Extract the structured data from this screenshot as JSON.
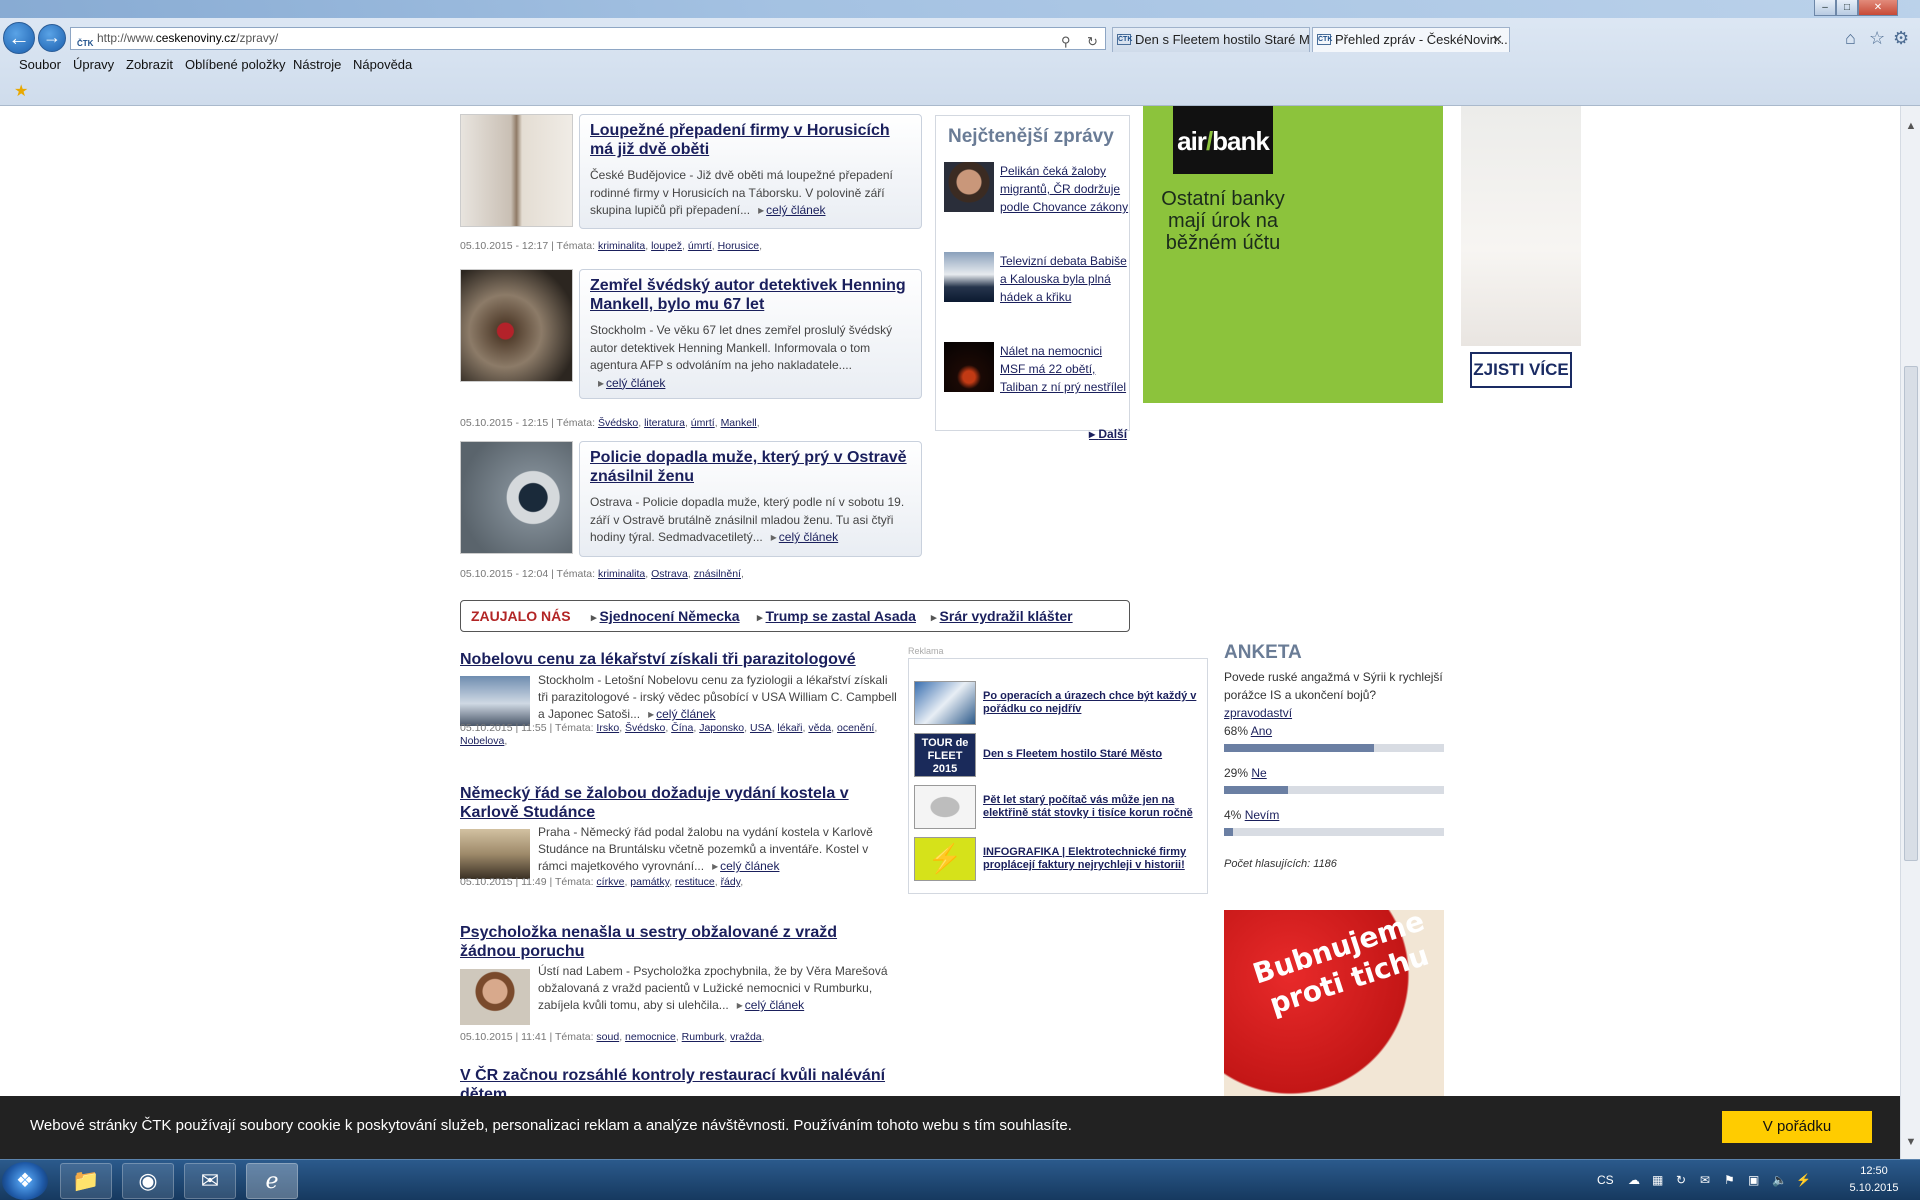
{
  "browser": {
    "url_prefix": "http://www.",
    "url_domain": "ceskenoviny.cz",
    "url_path": "/zpravy/",
    "tabs": [
      {
        "label": "Den s Fleetem hostilo Staré Mě...",
        "fav": "ČTK"
      },
      {
        "label": "Přehled zpráv - ČeskéNovin...",
        "fav": "ČTK",
        "close": "✕"
      }
    ],
    "menu": [
      "Soubor",
      "Úpravy",
      "Zobrazit",
      "Oblíbené položky",
      "Nástroje",
      "Nápověda"
    ],
    "nav_back": "←",
    "nav_forward": "→",
    "icons": {
      "search": "⚲",
      "refresh": "↻",
      "home": "⌂",
      "star": "☆",
      "gear": "⚙",
      "fav_star": "★"
    },
    "window_buttons": {
      "min": "–",
      "max": "□",
      "close": "✕"
    },
    "address_ico": "ČTK"
  },
  "articles": [
    {
      "title": "Loupežné přepadení firmy v Horusicích má již dvě oběti",
      "text": "České Budějovice - Již dvě oběti má loupežné přepadení rodinné firmy v Horusicích na Táborsku. V polovině září skupina lupičů při přepadení...",
      "more": "celý článek",
      "meta": "05.10.2015 - 12:17 | Témata:",
      "tags": [
        "kriminalita",
        "loupež",
        "úmrtí",
        "Horusice"
      ]
    },
    {
      "title": "Zemřel švédský autor detektivek Henning Mankell, bylo mu 67 let",
      "text": "Stockholm - Ve věku 67 let dnes zemřel proslulý švédský autor detektivek Henning Mankell. Informovala o tom agentura AFP s odvoláním na jeho nakladatele....",
      "more": "celý článek",
      "meta": "05.10.2015 - 12:15 | Témata:",
      "tags": [
        "Švédsko",
        "literatura",
        "úmrtí",
        "Mankell"
      ]
    },
    {
      "title": "Policie dopadla muže, který prý v Ostravě znásilnil ženu",
      "text": "Ostrava - Policie dopadla muže, který podle ní v sobotu 19. září v Ostravě brutálně znásilnil mladou ženu. Tu asi čtyři hodiny týral. Sedmadvacetiletý...",
      "more": "celý článek",
      "meta": "05.10.2015 - 12:04 | Témata:",
      "tags": [
        "kriminalita",
        "Ostrava",
        "znásilnění"
      ]
    }
  ],
  "most_read": {
    "title": "Nejčtenější zprávy",
    "items": [
      "Pelikán čeká žaloby migrantů, ČR dodržuje podle Chovance zákony",
      "Televizní debata Babiše a Kalouska byla plná hádek a křiku",
      "Nálet na nemocnici MSF má 22 obětí, Taliban z ní prý nestřílel"
    ],
    "more": "Další"
  },
  "ad_airbank": {
    "logo_a": "air",
    "logo_slash": "/",
    "logo_b": "bank",
    "text": "Ostatní banky mají úrok na běžném účtu"
  },
  "ad_bed": {
    "button": "ZJISTI VÍCE"
  },
  "zaujalo": {
    "label": "ZAUJALO NÁS",
    "links": [
      "Sjednocení Německa",
      "Trump se zastal Asada",
      "Srár vydražil klášter"
    ]
  },
  "list": [
    {
      "title": "Nobelovu cenu za lékařství získali tři parazitologové",
      "text": "Stockholm - Letošní Nobelovu cenu za fyziologii a lékařství získali tři parazitologové - irský vědec působící v USA William C. Campbell a Japonec Satoši...",
      "more": "celý článek",
      "meta": "05.10.2015 | 11:55 | Témata:",
      "tags": [
        "Irsko",
        "Švédsko",
        "Čína",
        "Japonsko",
        "USA",
        "lékaři",
        "věda",
        "ocenění",
        "Nobelova"
      ]
    },
    {
      "title": "Německý řád se žalobou dožaduje vydání kostela v Karlově Studánce",
      "text": "Praha - Německý řád podal žalobu na vydání kostela v Karlově Studánce na Bruntálsku včetně pozemků a inventáře. Kostel v rámci majetkového vyrovnání...",
      "more": "celý článek",
      "meta": "05.10.2015 | 11:49 | Témata:",
      "tags": [
        "církve",
        "památky",
        "restituce",
        "řády"
      ]
    },
    {
      "title": "Psycholožka nenašla u sestry obžalované z vražd žádnou poruchu",
      "text": "Ústí nad Labem - Psycholožka zpochybnila, že by Věra Marešová obžalovaná z vražd pacientů v Lužické nemocnici v Rumburku, zabíjela kvůli tomu, aby si ulehčila...",
      "more": "celý článek",
      "meta": "05.10.2015 | 11:41 | Témata:",
      "tags": [
        "soud",
        "nemocnice",
        "Rumburk",
        "vražda"
      ]
    },
    {
      "title": "V ČR začnou rozsáhlé kontroly restaurací kvůli nalévání dětem"
    }
  ],
  "reklama": {
    "label": "Reklama",
    "items": [
      "Po operacích a úrazech chce být každý v pořádku co nejdřív",
      "Den s Fleetem hostilo Staré Město",
      "Pět let starý počítač vás může jen na elektřině stát stovky i tisíce korun ročně",
      "INFOGRAFIKA | Elektrotechnické firmy proplácejí faktury nejrychleji v historii!"
    ],
    "thumb_text": {
      "tour": "TOUR de FLEET 2015"
    }
  },
  "poll": {
    "title": "ANKETA",
    "question": "Povede ruské angažmá v Sýrii k rychlejší porážce IS a ukončení bojů?",
    "category": "zpravodaství",
    "options": [
      {
        "pct_label": "68%",
        "label": "Ano",
        "fraction": 0.68
      },
      {
        "pct_label": "29%",
        "label": "Ne",
        "fraction": 0.29
      },
      {
        "pct_label": "4%",
        "label": "Nevím",
        "fraction": 0.04
      }
    ],
    "votes": "Počet hlasujících: 1186"
  },
  "ad_red": {
    "text": "Bubnujeme proti tichu"
  },
  "cookie": {
    "text": "Webové stránky ČTK používají soubory cookie k poskytování služeb, personalizaci reklam a analýze návštěvnosti. Používáním tohoto webu s tím souhlasíte.",
    "button": "V pořádku"
  },
  "taskbar": {
    "lang": "CS",
    "time": "12:50",
    "date": "5.10.2015"
  }
}
